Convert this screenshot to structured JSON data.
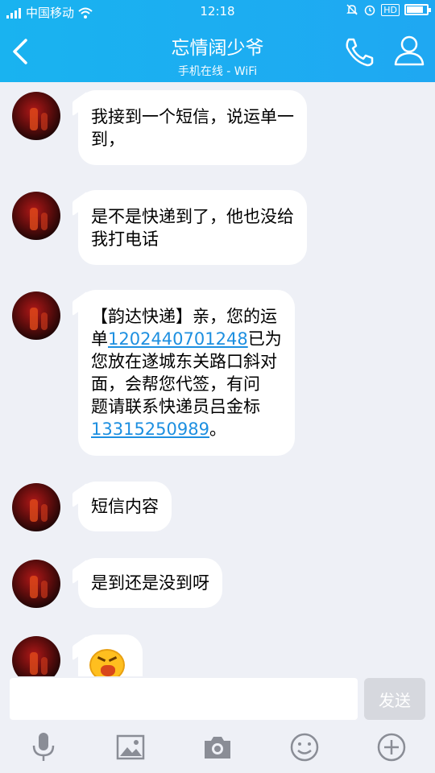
{
  "status": {
    "carrier": "中国移动",
    "time": "12:18",
    "network": "HD",
    "battery_level": 0.85
  },
  "header": {
    "title": "忘情阔少爷",
    "subtitle": "手机在线 - WiFi",
    "icons": [
      "chevron-left-icon",
      "phone-icon",
      "person-icon"
    ]
  },
  "messages": [
    {
      "lines": [
        "我接到一个短信，说运单一",
        "到，"
      ]
    },
    {
      "lines": [
        "是不是快递到了，他也没给",
        "我打电话"
      ]
    },
    {
      "parts": [
        {
          "pre": "【韵达快递】亲，您的运",
          "link": "",
          "post": ""
        },
        {
          "pre": "单",
          "link": "1202440701248",
          "post": "已为"
        },
        {
          "pre": "您放在遂城东关路口斜对",
          "link": "",
          "post": ""
        },
        {
          "pre": "面，会帮您代签，有问",
          "link": "",
          "post": ""
        },
        {
          "pre": "题请联系快递员吕金标",
          "link": "",
          "post": ""
        },
        {
          "pre": "",
          "link": "13315250989",
          "post": "。"
        }
      ]
    },
    {
      "lines": [
        "短信内容"
      ]
    },
    {
      "lines": [
        "是到还是没到呀"
      ]
    },
    {
      "emoji": "crying-face-emoji"
    }
  ],
  "input": {
    "placeholder": "",
    "send_label": "发送"
  },
  "toolbar": {
    "icons": [
      "microphone-icon",
      "image-icon",
      "camera-icon",
      "smile-icon",
      "plus-icon"
    ]
  },
  "colors": {
    "header": "#1ba9f0",
    "background": "#eef0f6",
    "link": "#1d8fe0"
  }
}
